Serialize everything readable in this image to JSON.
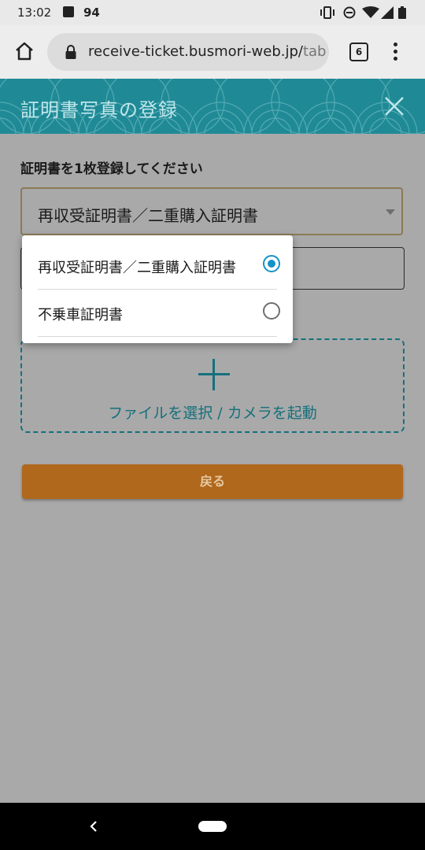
{
  "status_bar": {
    "time": "13:02",
    "notification_count": "94",
    "icons": [
      "image-icon",
      "vibrate-icon",
      "do-not-disturb-icon",
      "wifi-icon",
      "signal-icon",
      "battery-icon"
    ]
  },
  "browser": {
    "url": "receive-ticket.busmori-web.jp/",
    "url_overflow": "tab",
    "tab_count": "6"
  },
  "header": {
    "title": "証明書写真の登録",
    "accent_color": "#1f8a96"
  },
  "form": {
    "instruction": "証明書を1枚登録してください",
    "select_value": "再収受証明書／二重購入証明書",
    "dropdown_options": [
      {
        "label": "再収受証明書／二重購入証明書",
        "selected": true
      },
      {
        "label": "不乗車証明書",
        "selected": false
      }
    ],
    "upload_label": "ファイルを選択 / カメラを起動",
    "back_button": "戻る",
    "button_color": "#b0681d"
  }
}
